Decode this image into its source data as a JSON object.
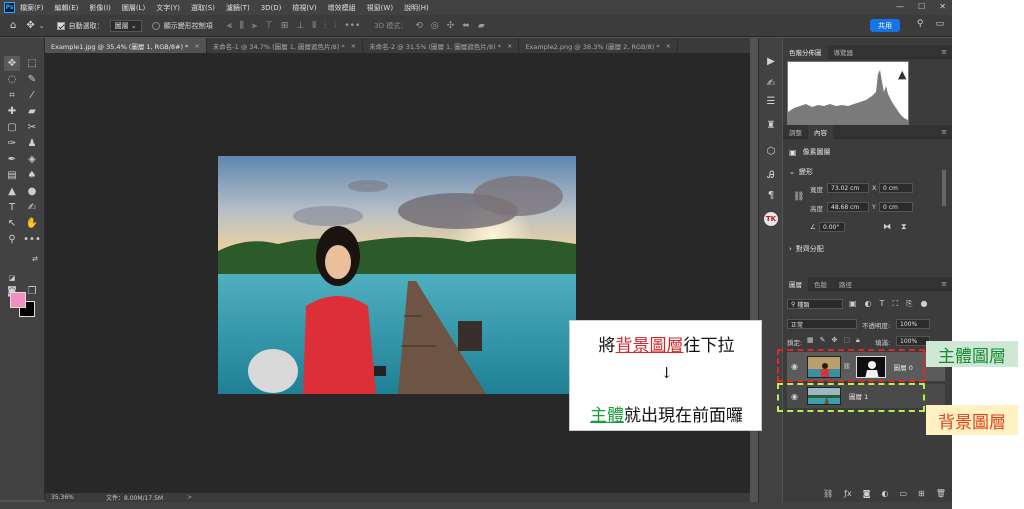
{
  "app": {
    "menus": [
      "檔案(F)",
      "編輯(E)",
      "影像(I)",
      "圖層(L)",
      "文字(Y)",
      "選取(S)",
      "濾鏡(T)",
      "3D(D)",
      "檢視(V)",
      "增效模組",
      "視窗(W)",
      "說明(H)"
    ],
    "logo_text": "Ps"
  },
  "options_bar": {
    "auto_select_label": "自動選取：",
    "auto_select_value": "圖層",
    "transform_controls_label": "顯示變形控制項",
    "mode_3d_label": "3D 模式：",
    "share_label": "共用"
  },
  "tabs": [
    {
      "label": "Example1.jpg @ 35.4% (圖層 1, RGB/8#) *",
      "active": true
    },
    {
      "label": "未命名-1 @ 34.7% (圖層 1, 圖層遮色片/8) *",
      "active": false
    },
    {
      "label": "未命名-2 @ 31.5% (圖層 1, 圖層遮色片/8) *",
      "active": false
    },
    {
      "label": "Example2.png @ 38.3% (圖層 2, RGB/8) *",
      "active": false
    }
  ],
  "tab_close": "×",
  "status": {
    "zoom": "35.36%",
    "doc": "文件：8.00M/17.5M",
    "arrow": ">"
  },
  "panels": {
    "histogram_tabs": [
      "色階分佈圖",
      "導覽器"
    ],
    "adjust_tabs": [
      "調整",
      "內容"
    ],
    "pixel_layer_label": "像素圖層",
    "transform_title": "變形",
    "width_label": "寬度",
    "width_value": "73.02 cm",
    "height_label": "高度",
    "height_value": "48.68 cm",
    "x_label": "X",
    "x_value": "0 cm",
    "y_label": "Y",
    "y_value": "0 cm",
    "angle_value": "0.00°",
    "align_title": "對齊分配",
    "layers_tabs": [
      "圖層",
      "色版",
      "路徑"
    ],
    "filter_kind": "種類",
    "blend_mode": "正常",
    "opacity_label": "不透明度:",
    "opacity_value": "100%",
    "lock_label": "鎖定:",
    "fill_label": "填滿:",
    "fill_value": "100%",
    "layers": [
      {
        "name": "圖層 0"
      },
      {
        "name": "圖層 1"
      }
    ]
  },
  "annotation": {
    "line1_pre": "將",
    "line1_hl": "背景圖層",
    "line1_post": "往下拉",
    "arrow": "↓",
    "line2_hl": "主體",
    "line2_post": "就出現在前面囉"
  },
  "labels": {
    "subject_layer": "主體圖層",
    "background_layer": "背景圖層"
  },
  "colors": {
    "foreground": "#f08fc0",
    "background": "#000000",
    "share_button": "#1473e6",
    "red_highlight": "#d62828",
    "green_highlight": "#18a03a"
  }
}
